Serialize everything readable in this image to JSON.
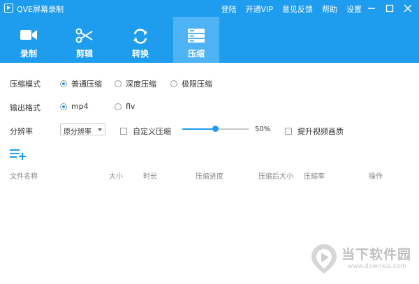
{
  "titlebar": {
    "title": "QVE屏幕录制",
    "links": [
      "登陆",
      "开通VIP",
      "意见反馈",
      "帮助",
      "设置"
    ]
  },
  "tabs": [
    {
      "label": "录制",
      "icon": "video-camera-icon"
    },
    {
      "label": "剪辑",
      "icon": "scissors-icon"
    },
    {
      "label": "转换",
      "icon": "refresh-icon"
    },
    {
      "label": "压缩",
      "icon": "compress-icon",
      "active": true
    }
  ],
  "settings": {
    "mode_label": "压缩模式",
    "mode_options": [
      "普通压缩",
      "深度压缩",
      "极限压缩"
    ],
    "mode_selected": "普通压缩",
    "format_label": "输出格式",
    "format_options": [
      "mp4",
      "flv"
    ],
    "format_selected": "mp4",
    "resolution_label": "分辨率",
    "resolution_value": "原分辨率",
    "custom_compress_label": "自定义压缩",
    "compress_percent": "50%",
    "compress_value": 0.5,
    "enhance_label": "提升视频画质"
  },
  "table": {
    "columns": [
      "文件名称",
      "大小",
      "时长",
      "压缩进度",
      "压缩后大小",
      "压缩率",
      "操作"
    ]
  },
  "watermark": {
    "name": "当下软件园",
    "url": "www.downxia.com"
  },
  "colors": {
    "accent": "#1e9cee",
    "active_tab": "#4db3f5"
  }
}
